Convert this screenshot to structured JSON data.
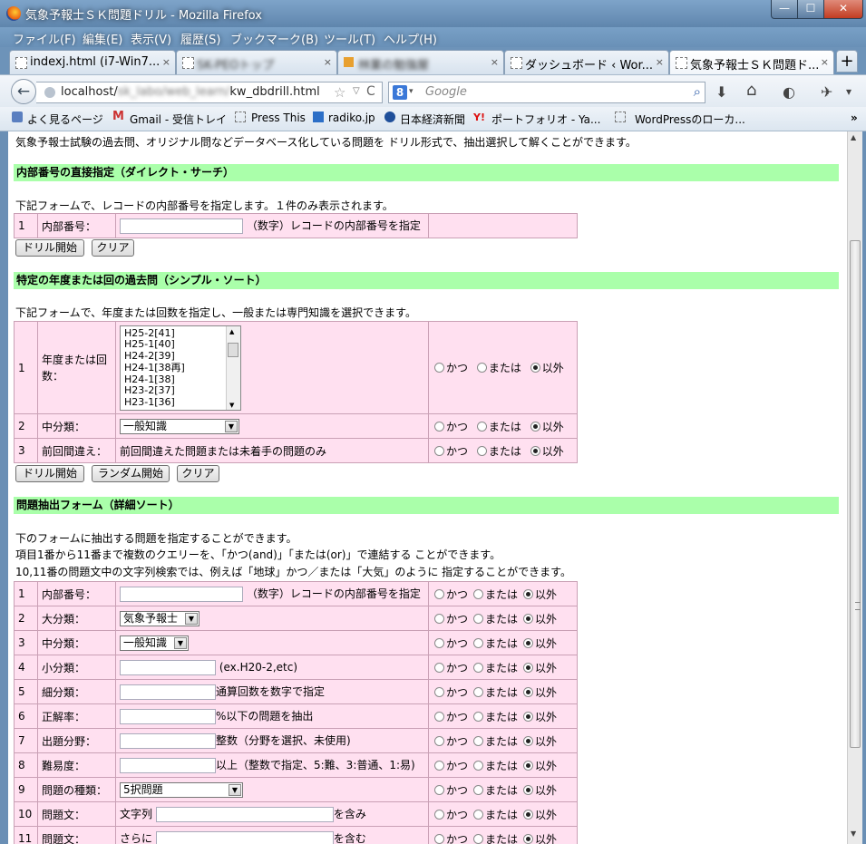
{
  "window": {
    "title": "気象予報士ＳＫ問題ドリル - Mozilla Firefox",
    "min": "—",
    "max": "☐",
    "close": "✕"
  },
  "menu": [
    "ファイル(F)",
    "編集(E)",
    "表示(V)",
    "履歴(S)",
    "ブックマーク(B)",
    "ツール(T)",
    "ヘルプ(H)"
  ],
  "tabs": [
    {
      "label": "indexj.html (i7-Win7...",
      "close": "×"
    },
    {
      "label": "SK-PEOトップ",
      "close": "×"
    },
    {
      "label": "林業の勉強屋",
      "close": "×"
    },
    {
      "label": "ダッシュボード ‹ Wor...",
      "close": "×"
    },
    {
      "label": "気象予報士ＳＫ問題ド...",
      "close": "×"
    }
  ],
  "newtab": "+",
  "nav": {
    "back": "←",
    "url_host": "localhost/",
    "url_hidden": "sk_labo/web_learn/",
    "url_file": "kw_dbdrill.html",
    "star": "☆",
    "dropdown": "▽",
    "reload": "C",
    "search_engine": "8",
    "search_placeholder": "Google",
    "search_icon": "⌕",
    "download": "⬇",
    "home": "⌂",
    "sync": "◐",
    "addon": "✈",
    "menu": "▾"
  },
  "bookmarks": [
    {
      "label": "よく見るページ"
    },
    {
      "label": "Gmail - 受信トレイ"
    },
    {
      "label": "Press This"
    },
    {
      "label": "radiko.jp"
    },
    {
      "label": "日本経済新聞"
    },
    {
      "label": "ポートフォリオ - Ya..."
    },
    {
      "label": "WordPressのローカ..."
    }
  ],
  "bookmarks_more": "»",
  "intro": "気象予報士試験の過去問、オリジナル問などデータベース化している問題を ドリル形式で、抽出選択して解くことができます。",
  "sec1": {
    "title": "内部番号の直接指定（ダイレクト・サーチ）",
    "desc": "下記フォームで、レコードの内部番号を指定します。１件のみ表示されます。",
    "row": {
      "num": "1",
      "label": "内部番号：",
      "hint": "（数字）レコードの内部番号を指定"
    },
    "btn_start": "ドリル開始",
    "btn_clear": "クリア"
  },
  "sec2": {
    "title": "特定の年度または回の過去問（シンプル・ソート）",
    "desc": "下記フォームで、年度または回数を指定し、一般または専門知識を選択できます。",
    "row1": {
      "num": "1",
      "label1": "年度または回",
      "label2": "数："
    },
    "list_items": [
      "H25-2[41]",
      "H25-1[40]",
      "H24-2[39]",
      "H24-1[38再]",
      "H24-1[38]",
      "H23-2[37]",
      "H23-1[36]"
    ],
    "row2": {
      "num": "2",
      "label": "中分類：",
      "select": "一般知識"
    },
    "row3": {
      "num": "3",
      "label": "前回間違え：",
      "text": "前回間違えた問題または未着手の問題のみ"
    },
    "btn_start": "ドリル開始",
    "btn_random": "ランダム開始",
    "btn_clear": "クリア"
  },
  "options": {
    "and": "かつ",
    "or": "または",
    "not": "以外"
  },
  "sec3": {
    "title": "問題抽出フォーム（詳細ソート）",
    "desc1": "下のフォームに抽出する問題を指定することができます。",
    "desc2": "項目1番から11番まで複数のクエリーを、「かつ(and)」「または(or)」で連結する ことができます。",
    "desc3": "10,11番の問題文中の文字列検索では、例えば「地球」かつ／または「大気」のように 指定することができます。",
    "rows": [
      {
        "num": "1",
        "label": "内部番号：",
        "hint": "（数字）レコードの内部番号を指定"
      },
      {
        "num": "2",
        "label": "大分類：",
        "select": "気象予報士"
      },
      {
        "num": "3",
        "label": "中分類：",
        "select": "一般知識"
      },
      {
        "num": "4",
        "label": "小分類：",
        "hint": "(ex.H20-2,etc)"
      },
      {
        "num": "5",
        "label": "細分類：",
        "hint": "通算回数を数字で指定"
      },
      {
        "num": "6",
        "label": "正解率：",
        "hint": "%以下の問題を抽出"
      },
      {
        "num": "7",
        "label": "出題分野：",
        "hint": "整数（分野を選択、未使用)"
      },
      {
        "num": "8",
        "label": "難易度：",
        "hint": "以上（整数で指定、5:難、3:普通、1:易)"
      },
      {
        "num": "9",
        "label": "問題の種類：",
        "select": "5択問題"
      },
      {
        "num": "10",
        "label": "問題文：",
        "pre": "文字列",
        "hint": "を含み"
      },
      {
        "num": "11",
        "label": "問題文：",
        "pre": "さらに",
        "hint": "を含む"
      }
    ]
  }
}
